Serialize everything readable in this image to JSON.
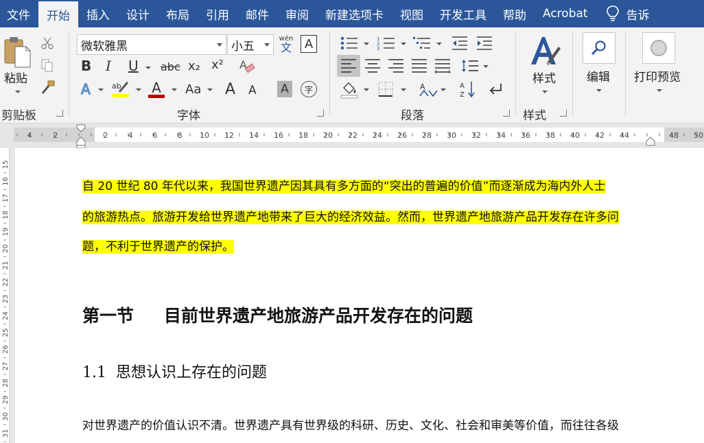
{
  "tabs": [
    "文件",
    "开始",
    "插入",
    "设计",
    "布局",
    "引用",
    "邮件",
    "审阅",
    "新建选项卡",
    "视图",
    "开发工具",
    "帮助",
    "Acrobat"
  ],
  "active_tab": "开始",
  "tell_me": "告诉",
  "ribbon": {
    "clipboard": {
      "paste_label": "粘贴",
      "group_label": "剪贴板"
    },
    "font": {
      "font_name": "微软雅黑",
      "font_size": "小五",
      "wen_top": "wén",
      "wen_bottom": "文",
      "char_border": "A",
      "bold": "B",
      "italic": "I",
      "underline": "U",
      "strike": "abc",
      "subscript": "x₂",
      "superscript": "x²",
      "text_effect": "A",
      "font_color": "A",
      "change_case": "Aa",
      "grow": "A",
      "shrink": "A",
      "shading": "A",
      "enclose": "字",
      "group_label": "字体"
    },
    "paragraph": {
      "group_label": "段落"
    },
    "styles": {
      "styles_label": "样式",
      "group_label": "样式"
    },
    "editing": {
      "label": "编辑"
    },
    "print": {
      "label": "打印预览"
    }
  },
  "ruler": {
    "labels": [
      "4",
      "2",
      "2",
      "4",
      "6",
      "8",
      "10",
      "12",
      "14",
      "16",
      "18",
      "20",
      "22",
      "24",
      "26",
      "28",
      "30",
      "32",
      "34",
      "36",
      "38",
      "40",
      "42",
      "44",
      "48",
      "50"
    ]
  },
  "vruler": {
    "labels": [
      "15",
      "16",
      "17",
      "18",
      "19",
      "20",
      "21",
      "22",
      "23",
      "24",
      "25",
      "26",
      "27",
      "28",
      "29",
      "30",
      "31"
    ]
  },
  "document": {
    "para1_lines": [
      "自 20 世纪 80 年代以来，我国世界遗产因其具有多方面的“突出的普遍的价值”而逐渐成为海内外人士",
      "的旅游热点。旅游开发给世界遗产地带来了巨大的经济效益。然而，世界遗产地旅游产品开发存在许多问",
      "题，不利于世界遗产的保护。"
    ],
    "heading1_number": "第一节",
    "heading1_text": "目前世界遗产地旅游产品开发存在的问题",
    "heading2": "1.1  思想认识上存在的问题",
    "para2": "对世界遗产的价值认识不清。世界遗产具有世界级的科研、历史、文化、社会和审美等价值，而往往各级"
  },
  "colors": {
    "titlebar": "#2b579a",
    "highlight": "#ffff00",
    "font_color_bar": "#c00000",
    "highlight_bar": "#ffff00"
  }
}
